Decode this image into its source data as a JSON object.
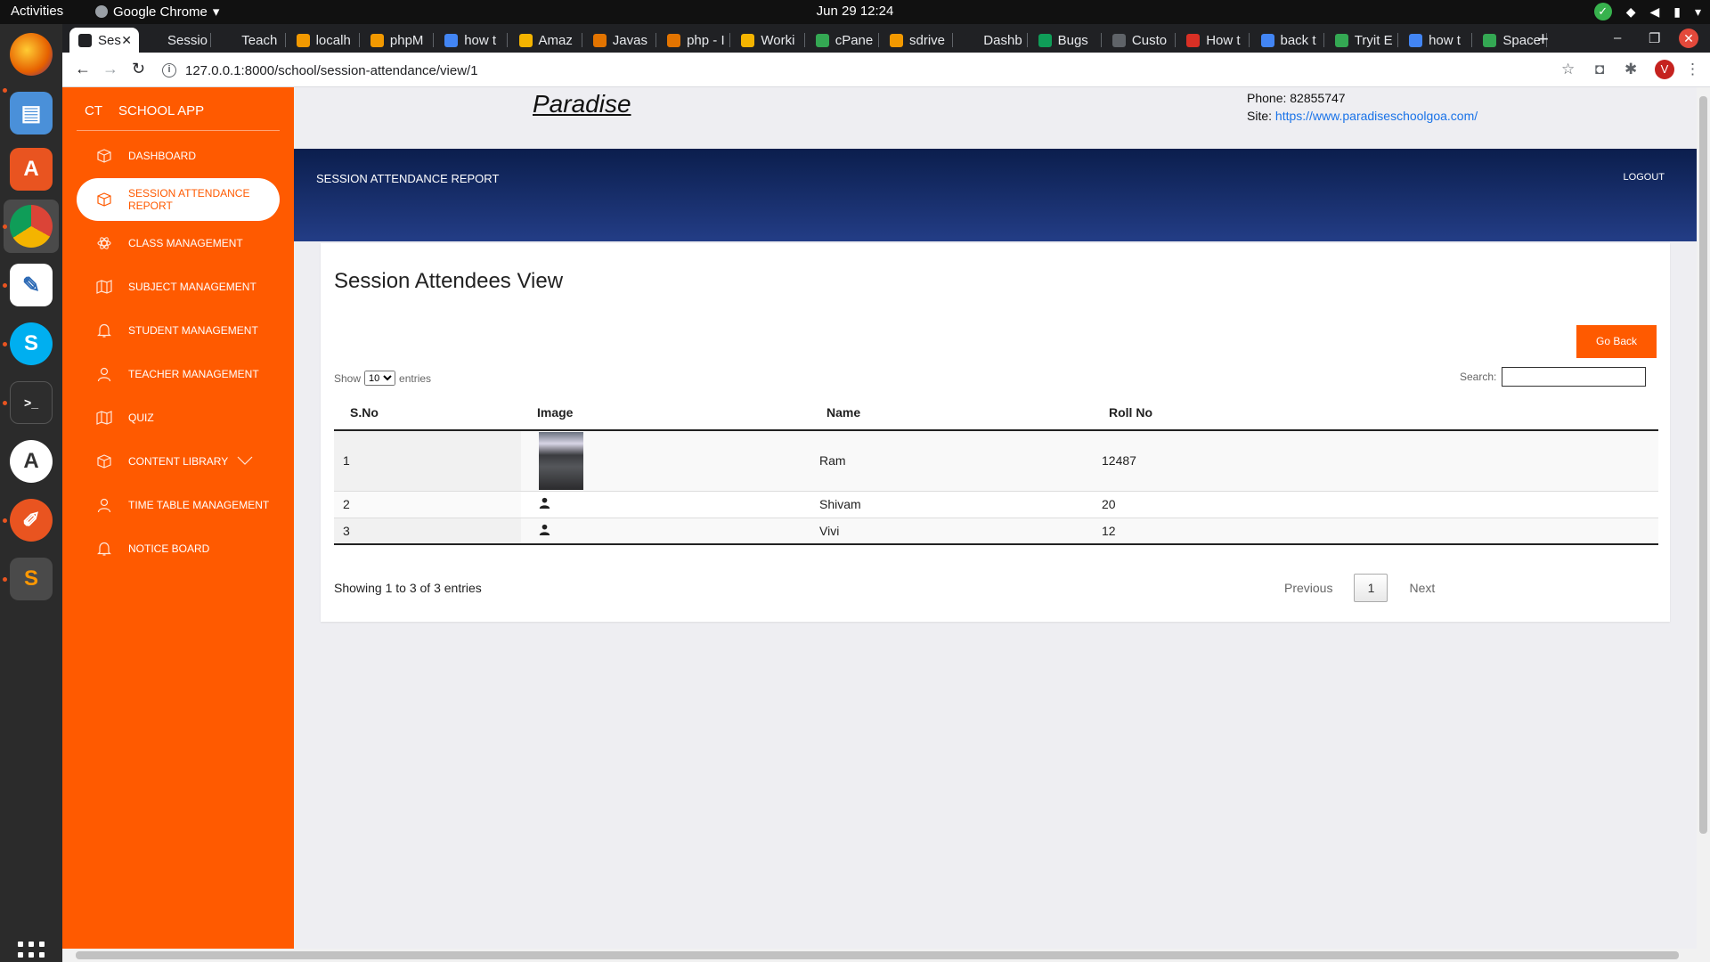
{
  "os": {
    "activities": "Activities",
    "app_name": "Google Chrome",
    "clock": "Jun 29  12:24"
  },
  "browser": {
    "tabs": [
      {
        "label": "Ses",
        "color": "#202124"
      },
      {
        "label": "Sessio",
        "color": "#202124"
      },
      {
        "label": "Teach",
        "color": "#202124"
      },
      {
        "label": "localh",
        "color": "#f29900"
      },
      {
        "label": "phpM",
        "color": "#f29900"
      },
      {
        "label": "how t",
        "color": "#4285f4"
      },
      {
        "label": "Amaz",
        "color": "#f4b400"
      },
      {
        "label": "Javas",
        "color": "#e37400"
      },
      {
        "label": "php - I",
        "color": "#e37400"
      },
      {
        "label": "Worki",
        "color": "#f4b400"
      },
      {
        "label": "cPane",
        "color": "#34a853"
      },
      {
        "label": "sdrive",
        "color": "#f29900"
      },
      {
        "label": "Dashb",
        "color": "#202124"
      },
      {
        "label": "Bugs",
        "color": "#0f9d58"
      },
      {
        "label": "Custo",
        "color": "#5f6368"
      },
      {
        "label": "How t",
        "color": "#d93025"
      },
      {
        "label": "back t",
        "color": "#4285f4"
      },
      {
        "label": "Tryit E",
        "color": "#34a853"
      },
      {
        "label": "how t",
        "color": "#4285f4"
      },
      {
        "label": "Space",
        "color": "#34a853"
      }
    ],
    "url": "127.0.0.1:8000/school/session-attendance/view/1",
    "avatar_letter": "V"
  },
  "sidebar": {
    "brand_short": "CT",
    "brand_name": "SCHOOL APP",
    "items": [
      {
        "label": "DASHBOARD",
        "icon": "box-icon"
      },
      {
        "label": "SESSION ATTENDANCE REPORT",
        "icon": "box-icon",
        "active": true
      },
      {
        "label": "CLASS MANAGEMENT",
        "icon": "atom-icon"
      },
      {
        "label": "SUBJECT MANAGEMENT",
        "icon": "map-icon"
      },
      {
        "label": "STUDENT MANAGEMENT",
        "icon": "bell-icon"
      },
      {
        "label": "TEACHER MANAGEMENT",
        "icon": "user-icon"
      },
      {
        "label": "QUIZ",
        "icon": "map-icon"
      },
      {
        "label": "CONTENT LIBRARY",
        "icon": "box-icon",
        "chevron": true
      },
      {
        "label": "TIME TABLE MANAGEMENT",
        "icon": "user-icon"
      },
      {
        "label": "NOTICE BOARD",
        "icon": "bell-icon"
      }
    ]
  },
  "header": {
    "school_name": "Paradise",
    "phone_label": "Phone:",
    "phone": "82855747",
    "site_label": "Site:",
    "site_url": "https://www.paradiseschoolgoa.com/",
    "page_title": "SESSION ATTENDANCE REPORT",
    "logout": "LOGOUT"
  },
  "card": {
    "title": "Session Attendees View",
    "go_back": "Go Back",
    "show_label": "Show",
    "entries_value": "10",
    "entries_label": "entries",
    "search_label": "Search:",
    "columns": [
      "S.No",
      "Image",
      "Name",
      "Roll No"
    ],
    "rows": [
      {
        "no": "1",
        "image": "photo",
        "name": "Ram",
        "roll": "12487"
      },
      {
        "no": "2",
        "image": "person-icon",
        "name": "Shivam",
        "roll": "20"
      },
      {
        "no": "3",
        "image": "person-icon",
        "name": "Vivi",
        "roll": "12"
      }
    ],
    "info": "Showing 1 to 3 of 3 entries",
    "previous": "Previous",
    "current_page": "1",
    "next": "Next"
  },
  "colors": {
    "accent": "#ff5a00",
    "header_dark": "#0b1e4d",
    "header_light": "#233d86"
  }
}
